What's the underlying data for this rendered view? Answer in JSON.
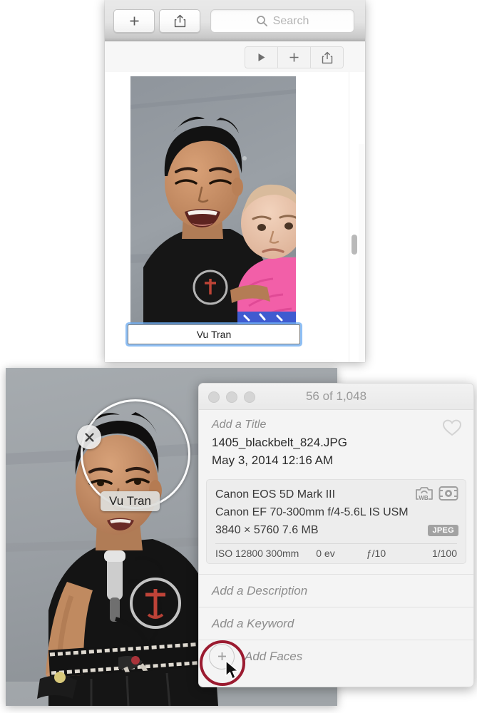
{
  "upper_window": {
    "toolbar": {
      "add_button_label": "+",
      "share_icon": "share-icon",
      "search_placeholder": "Search",
      "search_icon": "search-icon"
    },
    "subtoolbar": {
      "play_icon": "play-icon",
      "add_icon": "plus-icon",
      "share_icon": "share-icon"
    },
    "face_name_field": {
      "value": "Vu Tran"
    },
    "scrollbar": "vertical-scrollbar"
  },
  "lower_photo": {
    "face_tag": {
      "name": "Vu Tran",
      "close_icon": "close-icon",
      "circle": "face-detection-circle"
    }
  },
  "info_panel": {
    "titlebar": {
      "count": "56 of 1,048",
      "close_dot": "close-button",
      "minimize_dot": "minimize-button",
      "zoom_dot": "zoom-button"
    },
    "title_placeholder": "Add a Title",
    "filename": "1405_blackbelt_824.JPG",
    "date": "May 3, 2014   12:16 AM",
    "favorite_icon": "heart-icon",
    "exif": {
      "camera": "Canon EOS 5D Mark III",
      "lens": "Canon EF 70-300mm f/4-5.6L IS USM",
      "dimensions_size": "3840 × 5760   7.6 MB",
      "format_badge": "JPEG",
      "wb_icon": "camera-white-balance-icon",
      "metering_icon": "metering-mode-icon",
      "stats": {
        "iso": "ISO 12800",
        "focal_length": "300mm",
        "exposure_compensation": "0 ev",
        "aperture": "ƒ/10",
        "shutter_speed": "1/100"
      }
    },
    "description_placeholder": "Add a Description",
    "keyword_placeholder": "Add a Keyword",
    "faces_label": "Add Faces",
    "faces_add_icon": "plus-circle-icon"
  },
  "annotation": {
    "highlight_color": "#9b1b30",
    "cursor_icon": "mouse-cursor"
  }
}
